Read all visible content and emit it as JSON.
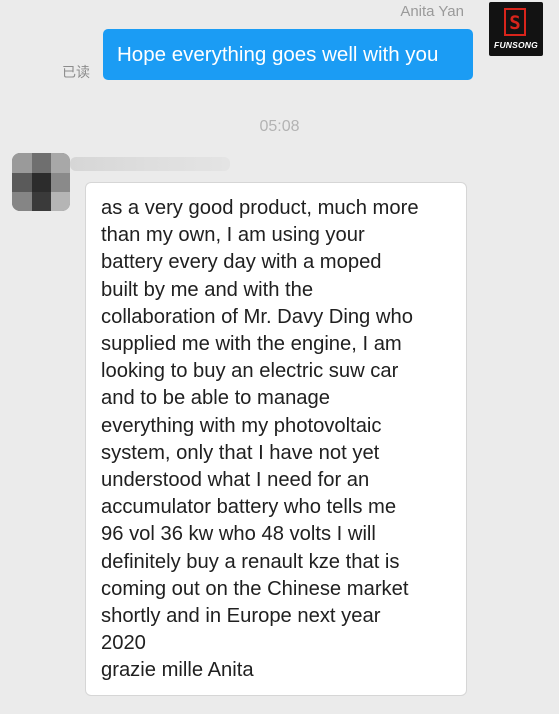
{
  "outgoing": {
    "sender_name": "Anita Yan",
    "text": "Hope everything goes well with you",
    "read_status": "已读",
    "avatar_brand": "FUNSONG",
    "avatar_letter": "S"
  },
  "timestamp": "05:08",
  "incoming": {
    "lines": [
      "as a very good product, much more",
      "than my own, I am using your",
      "battery every day with a moped",
      "built by me and with the",
      "collaboration of Mr. Davy Ding who",
      "supplied me with the engine, I am",
      "looking to buy an electric suw car",
      "and to be able to manage",
      "everything with my photovoltaic",
      "system, only that I have not yet",
      "understood what I need for an",
      "accumulator battery who tells me",
      "96 vol 36 kw who 48 volts I will",
      "definitely buy a renault kze that is",
      "coming out on the Chinese market",
      "shortly and in Europe next year",
      "2020",
      "grazie mille Anita"
    ]
  },
  "colors": {
    "background": "#ebebeb",
    "outgoing_bubble": "#1b9cf4",
    "incoming_bubble": "#ffffff",
    "brand_red": "#d8241b"
  }
}
